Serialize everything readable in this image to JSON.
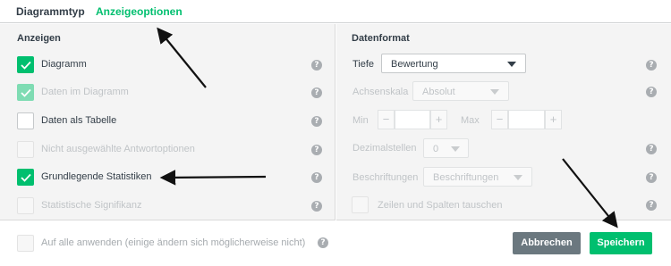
{
  "tabs": [
    {
      "label": "Diagrammtyp"
    },
    {
      "label": "Anzeigeoptionen"
    }
  ],
  "left_panel": {
    "title": "Anzeigen",
    "rows": [
      {
        "label": "Diagramm"
      },
      {
        "label": "Daten im Diagramm"
      },
      {
        "label": "Daten als Tabelle"
      },
      {
        "label": "Nicht ausgewählte Antwortoptionen"
      },
      {
        "label": "Grundlegende Statistiken"
      },
      {
        "label": "Statistische Signifikanz"
      }
    ]
  },
  "right_panel": {
    "title": "Datenformat",
    "tiefe_label": "Tiefe",
    "tiefe_value": "Bewertung",
    "achsenskala_label": "Achsenskala",
    "achsenskala_value": "Absolut",
    "min_label": "Min",
    "max_label": "Max",
    "minus": "−",
    "plus": "+",
    "dezimal_label": "Dezimalstellen",
    "dezimal_value": "0",
    "beschriftungen_label": "Beschriftungen",
    "beschriftungen_value": "Beschriftungen",
    "swap_label": "Zeilen und Spalten tauschen"
  },
  "help_glyph": "?",
  "footer": {
    "apply_all_label": "Auf alle anwenden (einige ändern sich möglicherweise nicht)",
    "cancel_label": "Abbrechen",
    "save_label": "Speichern"
  },
  "colors": {
    "accent": "#00bf6f",
    "cancel": "#6b787f",
    "panel_bg": "#f4f4f4"
  }
}
